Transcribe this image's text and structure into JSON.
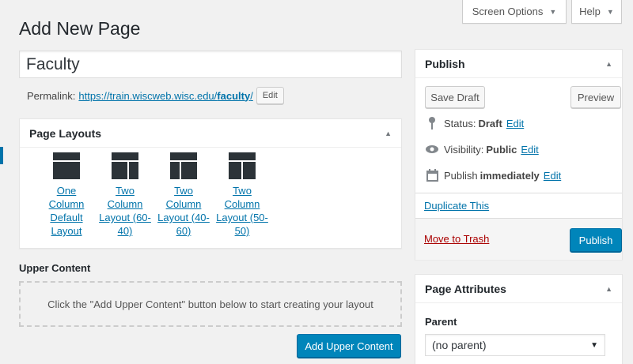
{
  "screen_options": {
    "label": "Screen Options"
  },
  "help": {
    "label": "Help"
  },
  "page": {
    "heading": "Add New Page",
    "title_value": "Faculty"
  },
  "permalink": {
    "label": "Permalink:",
    "url_prefix": "https://train.wiscweb.wisc.edu/",
    "slug": "faculty",
    "url_suffix": "/",
    "edit_label": "Edit"
  },
  "page_layouts": {
    "title": "Page Layouts",
    "items": [
      {
        "label": "One Column Default Layout",
        "icon": "one-column-layout-icon"
      },
      {
        "label": "Two Column Layout (60-40)",
        "icon": "two-column-60-40-layout-icon"
      },
      {
        "label": "Two Column Layout (40-60)",
        "icon": "two-column-40-60-layout-icon"
      },
      {
        "label": "Two Column Layout (50-50)",
        "icon": "two-column-50-50-layout-icon"
      }
    ]
  },
  "upper_content": {
    "label": "Upper Content",
    "placeholder": "Click the \"Add Upper Content\" button below to start creating your layout",
    "button": "Add Upper Content"
  },
  "publish": {
    "title": "Publish",
    "save_draft": "Save Draft",
    "preview": "Preview",
    "status_label": "Status:",
    "status_value": "Draft",
    "visibility_label": "Visibility:",
    "visibility_value": "Public",
    "publish_label": "Publish",
    "publish_value": "immediately",
    "edit": "Edit",
    "duplicate": "Duplicate This",
    "trash": "Move to Trash",
    "publish_button": "Publish"
  },
  "page_attributes": {
    "title": "Page Attributes",
    "parent_label": "Parent",
    "parent_value": "(no parent)"
  },
  "colors": {
    "link": "#0073aa",
    "primary": "#0085ba",
    "trash": "#a00"
  }
}
